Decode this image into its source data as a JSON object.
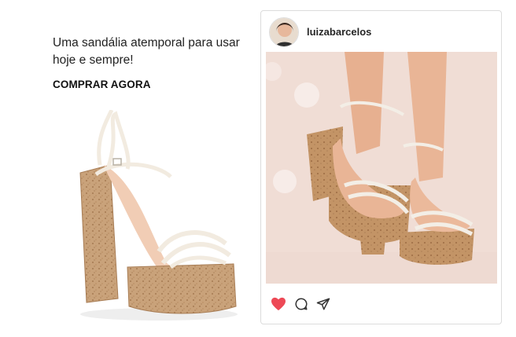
{
  "promo": {
    "tagline": "Uma sandália atemporal para usar hoje e sempre!",
    "cta_label": "COMPRAR AGORA"
  },
  "post": {
    "username": "luizabarcelos",
    "liked": true,
    "like_color": "#ed4956",
    "icons": [
      "heart-icon",
      "comment-icon",
      "share-icon"
    ]
  }
}
